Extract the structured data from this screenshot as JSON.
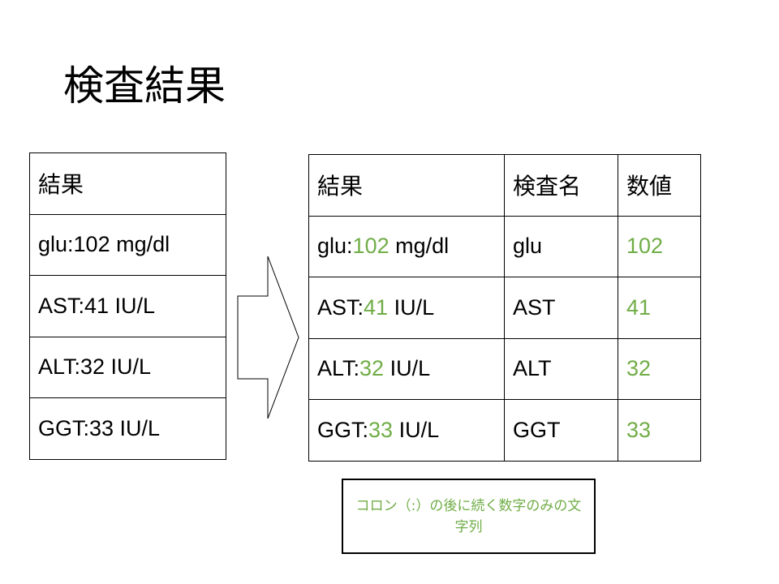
{
  "title": "検査結果",
  "colors": {
    "accent": "#70ad47",
    "border": "#000000",
    "text": "#000000"
  },
  "left_table": {
    "header": "結果",
    "rows": [
      "glu:102 mg/dl",
      "AST:41 IU/L",
      "ALT:32 IU/L",
      "GGT:33 IU/L"
    ]
  },
  "arrow_icon": "right-arrow-icon",
  "right_table": {
    "headers": [
      "結果",
      "検査名",
      "数値"
    ],
    "rows": [
      {
        "prefix": "glu:",
        "value": "102",
        "suffix": " mg/dl",
        "name": "glu",
        "number": "102"
      },
      {
        "prefix": "AST:",
        "value": "41",
        "suffix": " IU/L",
        "name": "AST",
        "number": "41"
      },
      {
        "prefix": "ALT:",
        "value": "32",
        "suffix": " IU/L",
        "name": "ALT",
        "number": "32"
      },
      {
        "prefix": "GGT:",
        "value": "33",
        "suffix": " IU/L",
        "name": "GGT",
        "number": "33"
      }
    ]
  },
  "note": "コロン（:）の後に続く数字のみの文字列"
}
